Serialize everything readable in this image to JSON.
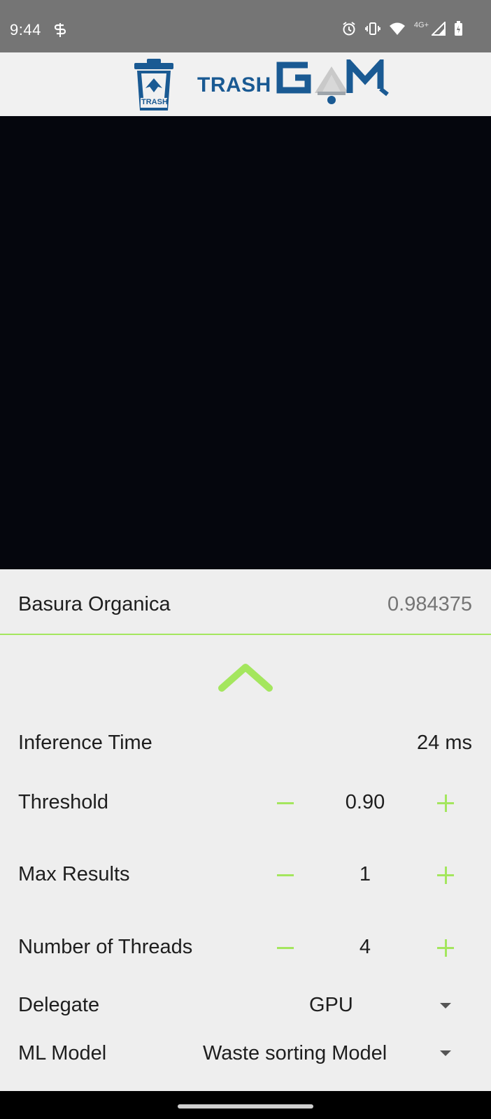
{
  "status_bar": {
    "time": "9:44",
    "network_type": "4G+",
    "icons": [
      "sync-icon",
      "alarm-icon",
      "vibrate-icon",
      "wifi-icon",
      "signal-icon",
      "battery-icon"
    ]
  },
  "header": {
    "logo_can_text": "TRASH",
    "logo_text": "TRASH",
    "colors": {
      "brand_blue": "#1a5a93",
      "accent_green": "#a4e65e"
    }
  },
  "result": {
    "label": "Basura Organica",
    "score": "0.984375"
  },
  "settings": {
    "inference_label": "Inference Time",
    "inference_value": "24 ms",
    "threshold_label": "Threshold",
    "threshold_value": "0.90",
    "max_results_label": "Max Results",
    "max_results_value": "1",
    "threads_label": "Number of Threads",
    "threads_value": "4",
    "delegate_label": "Delegate",
    "delegate_value": "GPU",
    "model_label": "ML Model",
    "model_value": "Waste sorting Model"
  }
}
